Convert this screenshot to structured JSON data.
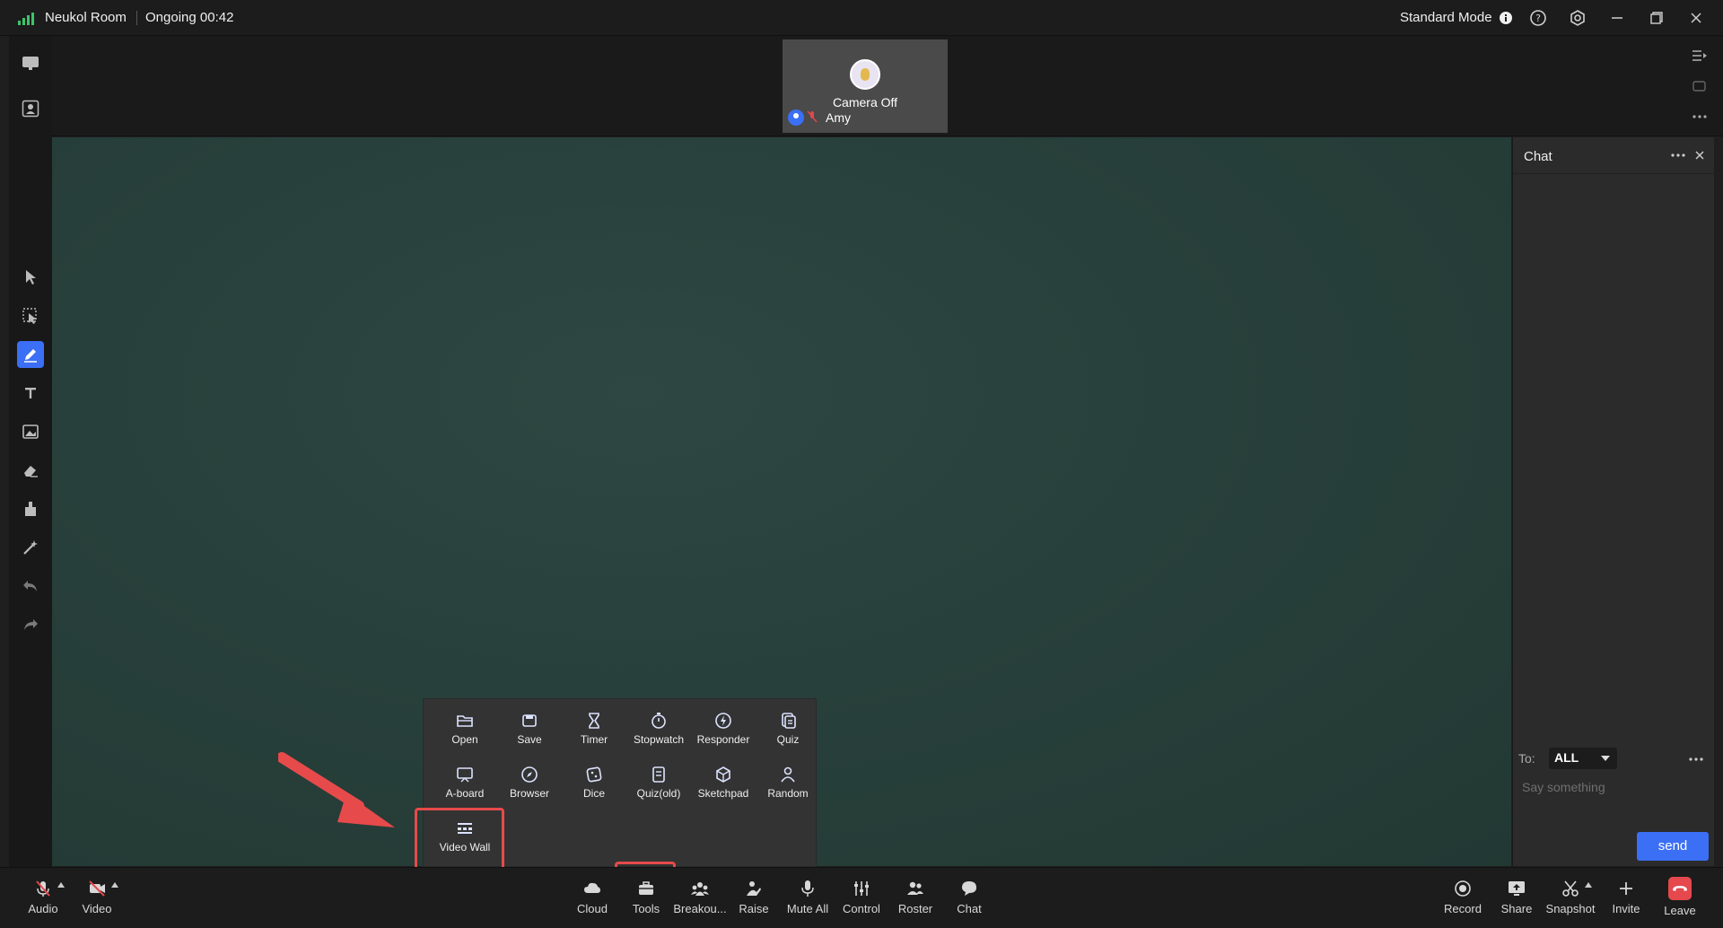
{
  "titlebar": {
    "room": "Neukol Room",
    "status": "Ongoing 00:42",
    "mode": "Standard Mode"
  },
  "video": {
    "camera_status": "Camera Off",
    "user": "Amy"
  },
  "chat": {
    "title": "Chat",
    "to_label": "To:",
    "to_value": "ALL",
    "placeholder": "Say something",
    "send": "send"
  },
  "tools": {
    "row1": [
      "Open",
      "Save",
      "Timer",
      "Stopwatch",
      "Responder",
      "Quiz"
    ],
    "row2": [
      "A-board",
      "Browser",
      "Dice",
      "Quiz(old)",
      "Sketchpad",
      "Random"
    ],
    "row3": [
      "Video Wall"
    ]
  },
  "bottom": {
    "audio": "Audio",
    "video": "Video",
    "cloud": "Cloud",
    "tools": "Tools",
    "breakout": "Breakou...",
    "raise": "Raise",
    "mute_all": "Mute All",
    "control": "Control",
    "roster": "Roster",
    "chat": "Chat",
    "record": "Record",
    "share": "Share",
    "snapshot": "Snapshot",
    "invite": "Invite",
    "leave": "Leave"
  },
  "colors": {
    "accent": "#3b6ff5",
    "highlight": "#e74a4a",
    "board": "#28403b",
    "leave": "#e5484d"
  }
}
